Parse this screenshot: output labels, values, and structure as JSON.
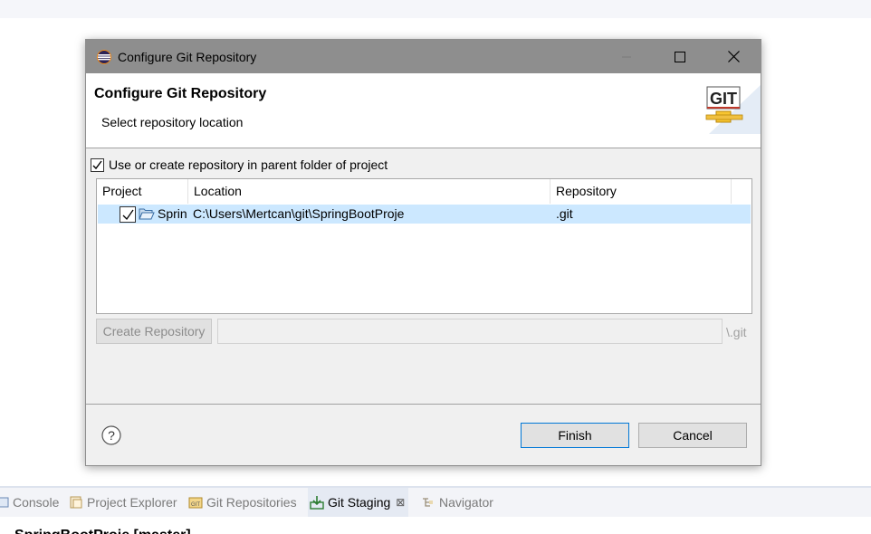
{
  "dialog": {
    "window_title": "Configure Git Repository",
    "header_title": "Configure Git Repository",
    "header_subtitle": "Select repository location",
    "git_logo_text": "GIT",
    "use_parent_checkbox": {
      "label": "Use or create repository in parent folder of project",
      "checked": true
    },
    "table": {
      "columns": [
        "Project",
        "Location",
        "Repository"
      ],
      "rows": [
        {
          "checked": true,
          "project": "Sprin",
          "location": "C:\\Users\\Mertcan\\git\\SpringBootProje",
          "repository": ".git"
        }
      ]
    },
    "create_repository_label": "Create Repository",
    "path_input_value": "",
    "git_suffix": "\\.git",
    "finish_label": "Finish",
    "cancel_label": "Cancel"
  },
  "bottom_tabs": {
    "items": [
      {
        "label": "Console",
        "icon": "console-icon"
      },
      {
        "label": "Project Explorer",
        "icon": "project-explorer-icon"
      },
      {
        "label": "Git Repositories",
        "icon": "git-repositories-icon"
      },
      {
        "label": "Git Staging",
        "icon": "git-staging-icon",
        "active": true,
        "close": "⊠"
      },
      {
        "label": "Navigator",
        "icon": "navigator-icon"
      }
    ]
  },
  "background_text": "SpringBootProje [master]",
  "colors": {
    "titlebar": "#8e8e8e",
    "selection": "#cce8ff",
    "accent_border": "#0078d7"
  }
}
